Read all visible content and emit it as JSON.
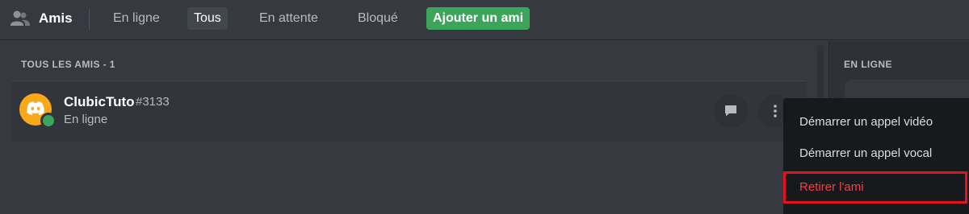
{
  "header": {
    "title": "Amis",
    "tabs": [
      {
        "label": "En ligne"
      },
      {
        "label": "Tous"
      },
      {
        "label": "En attente"
      },
      {
        "label": "Bloqué"
      }
    ],
    "add_friend_label": "Ajouter un ami"
  },
  "friends_list": {
    "section_header": "TOUS LES AMIS - 1",
    "friend": {
      "username": "ClubicTuto",
      "tag": "#3133",
      "status": "En ligne"
    }
  },
  "active_now": {
    "header": "EN LIGNE"
  },
  "context_menu": {
    "items": [
      {
        "label": "Démarrer un appel vidéo"
      },
      {
        "label": "Démarrer un appel vocal"
      },
      {
        "label": "Retirer l'ami"
      }
    ]
  },
  "colors": {
    "accent_green": "#3ba55c",
    "avatar": "#faa81a",
    "danger": "#ed4245",
    "highlight": "#e0141e"
  }
}
